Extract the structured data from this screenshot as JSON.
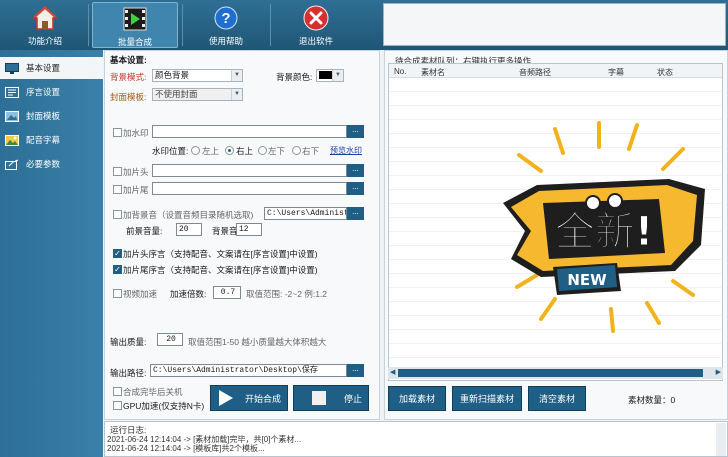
{
  "toolbar": {
    "items": [
      {
        "label": "功能介绍",
        "icon": "home-icon"
      },
      {
        "label": "批量合成",
        "icon": "film-play-icon"
      },
      {
        "label": "使用帮助",
        "icon": "help-icon"
      },
      {
        "label": "退出软件",
        "icon": "close-icon"
      }
    ]
  },
  "sidebar": {
    "items": [
      {
        "label": "基本设置",
        "icon": "monitor-icon"
      },
      {
        "label": "序言设置",
        "icon": "sequence-icon"
      },
      {
        "label": "封面模板",
        "icon": "cover-icon"
      },
      {
        "label": "配音字幕",
        "icon": "image-icon"
      },
      {
        "label": "必要参数",
        "icon": "params-icon"
      }
    ]
  },
  "basic": {
    "section_title": "基本设置:",
    "bg_mode_label": "背景模式:",
    "bg_mode_value": "颜色背景",
    "bg_color_label": "背景颜色:",
    "bg_color_value": "#000000",
    "cover_label": "封面模板:",
    "cover_value": "不使用封面",
    "watermark_label": "加水印",
    "watermark_path": "",
    "watermark_pos_label": "水印位置:",
    "positions": [
      "左上",
      "右上",
      "左下",
      "右下"
    ],
    "selected_position": "右上",
    "preview_link": "预览水印",
    "header_label": "加片头",
    "header_path": "",
    "footer_label": "加片尾",
    "footer_path": "",
    "bgm_label": "加背景音（设置音频目录随机选取)",
    "bgm_path": "C:\\Users\\Administra",
    "front_volume_label": "前景音量:",
    "front_volume": "20",
    "bg_volume_label": "背景音量:",
    "bg_volume": "12",
    "intro_label": "加片头序言（支持配音、文案请在[序言设置]中设置)",
    "intro_checked": true,
    "outro_label": "加片尾序言（支持配音、文案请在[序言设置]中设置)",
    "outro_checked": true,
    "speed_label": "视频加速",
    "speed_multiplier_label": "加速倍数:",
    "speed_multiplier": "0.7",
    "speed_range": "取值范围: -2~2 例:1.2",
    "quality_label": "输出质量:",
    "quality_value": "20",
    "quality_hint": "取值范围1-50 越小质量越大体积越大",
    "output_label": "输出路径:",
    "output_path": "C:\\Users\\Administrator\\Desktop\\保存",
    "shutdown_label": "合成完毕后关机",
    "gpu_label": "GPU加速(仅支持N卡)",
    "dots": "...",
    "start_button": "开始合成",
    "stop_button": "停止"
  },
  "queue": {
    "title": "待合成素材队列：右键执行更多操作",
    "columns": [
      "No.",
      "素材名",
      "音频路径",
      "字幕",
      "状态"
    ],
    "badge_text": "全新!",
    "badge_sub": "NEW",
    "load_button": "加载素材",
    "rescan_button": "重新扫描素材",
    "clear_button": "清空素材",
    "count_label": "素材数量：",
    "count_value": "0"
  },
  "log": {
    "title": "运行日志:",
    "lines": [
      "2021-06-24 12:14:04 -> [素材加载]完毕，共[0]个素材...",
      "2021-06-24 12:14:04 -> [模板库]共2个模板..."
    ]
  }
}
